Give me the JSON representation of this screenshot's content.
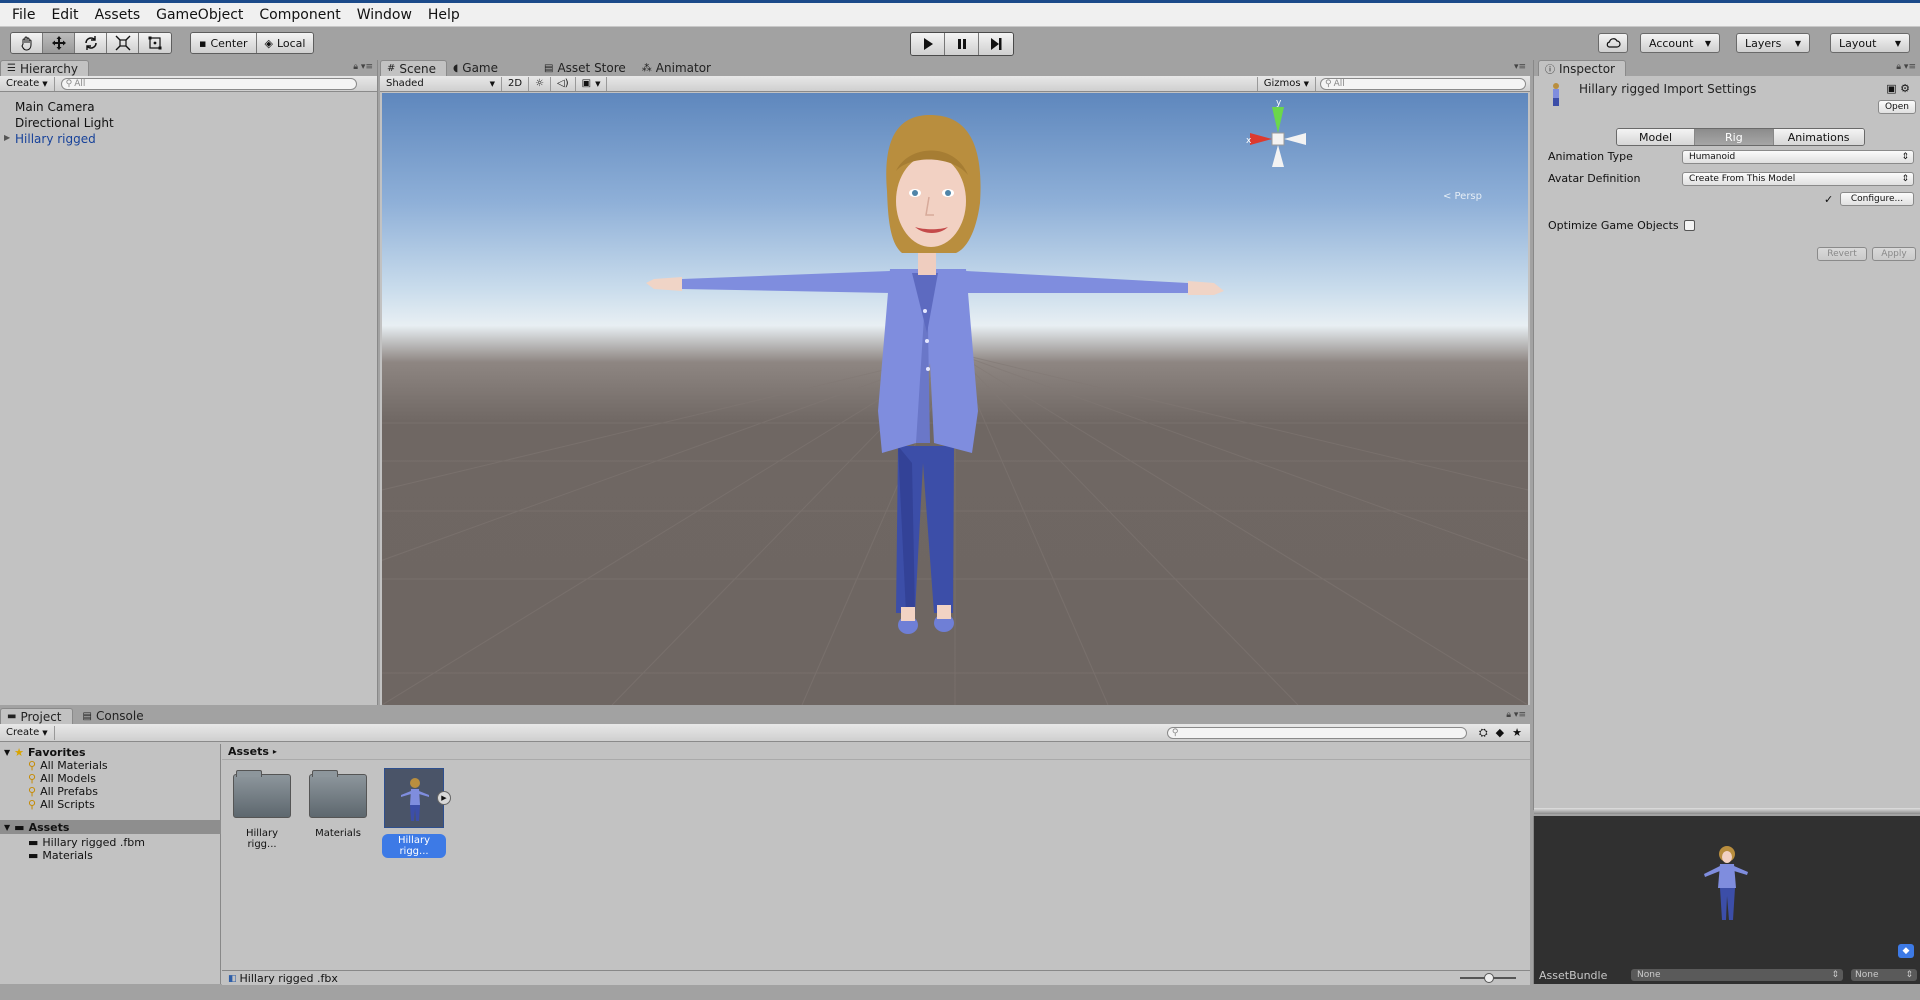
{
  "menu": [
    "File",
    "Edit",
    "Assets",
    "GameObject",
    "Component",
    "Window",
    "Help"
  ],
  "toolbar": {
    "pivot_center": "Center",
    "pivot_local": "Local",
    "account": "Account",
    "layers": "Layers",
    "layout": "Layout"
  },
  "hierarchy": {
    "tab": "Hierarchy",
    "create": "Create",
    "search_placeholder": "All",
    "items": [
      "Main Camera",
      "Directional Light",
      "Hillary rigged"
    ]
  },
  "scene": {
    "tabs": [
      "Scene",
      "Game",
      "Asset Store",
      "Animator"
    ],
    "shading": "Shaded",
    "mode_2d": "2D",
    "gizmos": "Gizmos",
    "search_placeholder": "All",
    "persp_label": "< Persp",
    "axis_labels": {
      "x": "x",
      "y": "y"
    }
  },
  "inspector": {
    "tab": "Inspector",
    "title": "Hillary rigged  Import Settings",
    "open": "Open",
    "segments": [
      "Model",
      "Rig",
      "Animations"
    ],
    "active_segment": "Rig",
    "animation_type_label": "Animation Type",
    "animation_type_value": "Humanoid",
    "avatar_definition_label": "Avatar Definition",
    "avatar_definition_value": "Create From This Model",
    "configure": "Configure...",
    "configure_check": "✓",
    "optimize_label": "Optimize Game Objects",
    "revert": "Revert",
    "apply": "Apply",
    "assetbundle_label": "AssetBundle",
    "assetbundle_value": "None",
    "assetbundle_variant": "None"
  },
  "project": {
    "tabs": [
      "Project",
      "Console"
    ],
    "create": "Create",
    "favorites_label": "Favorites",
    "favorites": [
      "All Materials",
      "All Models",
      "All Prefabs",
      "All Scripts"
    ],
    "assets_label": "Assets",
    "asset_folders": [
      "Hillary rigged .fbm",
      "Materials"
    ],
    "breadcrumb": "Assets",
    "tiles": [
      "Hillary rigg...",
      "Materials",
      "Hillary rigg..."
    ],
    "selected_path": "Hillary rigged .fbx"
  },
  "colors": {
    "selection_blue": "#3d7ae6",
    "hierarchy_blue": "#17429a",
    "preview_bg": "#303030"
  }
}
